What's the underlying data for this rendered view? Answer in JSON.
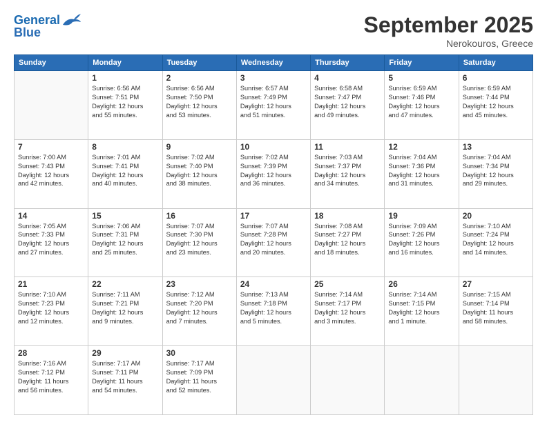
{
  "header": {
    "logo_line1": "General",
    "logo_line2": "Blue",
    "month": "September 2025",
    "location": "Nerokouros, Greece"
  },
  "weekdays": [
    "Sunday",
    "Monday",
    "Tuesday",
    "Wednesday",
    "Thursday",
    "Friday",
    "Saturday"
  ],
  "weeks": [
    [
      {
        "day": "",
        "info": ""
      },
      {
        "day": "1",
        "info": "Sunrise: 6:56 AM\nSunset: 7:51 PM\nDaylight: 12 hours\nand 55 minutes."
      },
      {
        "day": "2",
        "info": "Sunrise: 6:56 AM\nSunset: 7:50 PM\nDaylight: 12 hours\nand 53 minutes."
      },
      {
        "day": "3",
        "info": "Sunrise: 6:57 AM\nSunset: 7:49 PM\nDaylight: 12 hours\nand 51 minutes."
      },
      {
        "day": "4",
        "info": "Sunrise: 6:58 AM\nSunset: 7:47 PM\nDaylight: 12 hours\nand 49 minutes."
      },
      {
        "day": "5",
        "info": "Sunrise: 6:59 AM\nSunset: 7:46 PM\nDaylight: 12 hours\nand 47 minutes."
      },
      {
        "day": "6",
        "info": "Sunrise: 6:59 AM\nSunset: 7:44 PM\nDaylight: 12 hours\nand 45 minutes."
      }
    ],
    [
      {
        "day": "7",
        "info": "Sunrise: 7:00 AM\nSunset: 7:43 PM\nDaylight: 12 hours\nand 42 minutes."
      },
      {
        "day": "8",
        "info": "Sunrise: 7:01 AM\nSunset: 7:41 PM\nDaylight: 12 hours\nand 40 minutes."
      },
      {
        "day": "9",
        "info": "Sunrise: 7:02 AM\nSunset: 7:40 PM\nDaylight: 12 hours\nand 38 minutes."
      },
      {
        "day": "10",
        "info": "Sunrise: 7:02 AM\nSunset: 7:39 PM\nDaylight: 12 hours\nand 36 minutes."
      },
      {
        "day": "11",
        "info": "Sunrise: 7:03 AM\nSunset: 7:37 PM\nDaylight: 12 hours\nand 34 minutes."
      },
      {
        "day": "12",
        "info": "Sunrise: 7:04 AM\nSunset: 7:36 PM\nDaylight: 12 hours\nand 31 minutes."
      },
      {
        "day": "13",
        "info": "Sunrise: 7:04 AM\nSunset: 7:34 PM\nDaylight: 12 hours\nand 29 minutes."
      }
    ],
    [
      {
        "day": "14",
        "info": "Sunrise: 7:05 AM\nSunset: 7:33 PM\nDaylight: 12 hours\nand 27 minutes."
      },
      {
        "day": "15",
        "info": "Sunrise: 7:06 AM\nSunset: 7:31 PM\nDaylight: 12 hours\nand 25 minutes."
      },
      {
        "day": "16",
        "info": "Sunrise: 7:07 AM\nSunset: 7:30 PM\nDaylight: 12 hours\nand 23 minutes."
      },
      {
        "day": "17",
        "info": "Sunrise: 7:07 AM\nSunset: 7:28 PM\nDaylight: 12 hours\nand 20 minutes."
      },
      {
        "day": "18",
        "info": "Sunrise: 7:08 AM\nSunset: 7:27 PM\nDaylight: 12 hours\nand 18 minutes."
      },
      {
        "day": "19",
        "info": "Sunrise: 7:09 AM\nSunset: 7:26 PM\nDaylight: 12 hours\nand 16 minutes."
      },
      {
        "day": "20",
        "info": "Sunrise: 7:10 AM\nSunset: 7:24 PM\nDaylight: 12 hours\nand 14 minutes."
      }
    ],
    [
      {
        "day": "21",
        "info": "Sunrise: 7:10 AM\nSunset: 7:23 PM\nDaylight: 12 hours\nand 12 minutes."
      },
      {
        "day": "22",
        "info": "Sunrise: 7:11 AM\nSunset: 7:21 PM\nDaylight: 12 hours\nand 9 minutes."
      },
      {
        "day": "23",
        "info": "Sunrise: 7:12 AM\nSunset: 7:20 PM\nDaylight: 12 hours\nand 7 minutes."
      },
      {
        "day": "24",
        "info": "Sunrise: 7:13 AM\nSunset: 7:18 PM\nDaylight: 12 hours\nand 5 minutes."
      },
      {
        "day": "25",
        "info": "Sunrise: 7:14 AM\nSunset: 7:17 PM\nDaylight: 12 hours\nand 3 minutes."
      },
      {
        "day": "26",
        "info": "Sunrise: 7:14 AM\nSunset: 7:15 PM\nDaylight: 12 hours\nand 1 minute."
      },
      {
        "day": "27",
        "info": "Sunrise: 7:15 AM\nSunset: 7:14 PM\nDaylight: 11 hours\nand 58 minutes."
      }
    ],
    [
      {
        "day": "28",
        "info": "Sunrise: 7:16 AM\nSunset: 7:12 PM\nDaylight: 11 hours\nand 56 minutes."
      },
      {
        "day": "29",
        "info": "Sunrise: 7:17 AM\nSunset: 7:11 PM\nDaylight: 11 hours\nand 54 minutes."
      },
      {
        "day": "30",
        "info": "Sunrise: 7:17 AM\nSunset: 7:09 PM\nDaylight: 11 hours\nand 52 minutes."
      },
      {
        "day": "",
        "info": ""
      },
      {
        "day": "",
        "info": ""
      },
      {
        "day": "",
        "info": ""
      },
      {
        "day": "",
        "info": ""
      }
    ]
  ]
}
